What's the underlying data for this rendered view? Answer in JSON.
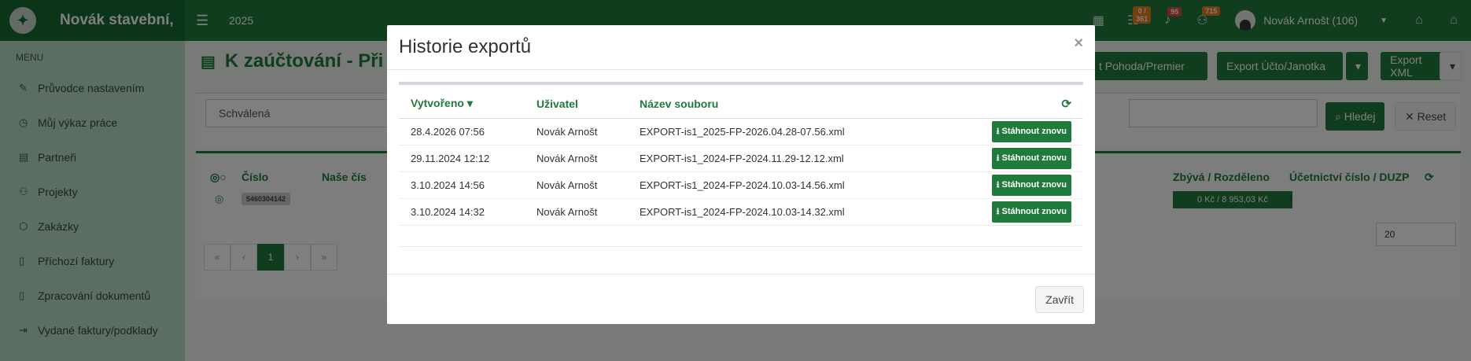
{
  "topbar": {
    "brand": "Novák stavební,",
    "year": "2025",
    "badge_tasks": "0 / 361",
    "badge_bell": "95",
    "badge_users": "715",
    "user_name": "Novák Arnošt (106)"
  },
  "sidebar": {
    "menu_header": "MENU",
    "items": [
      {
        "label": "Průvodce nastavením",
        "icon": "pencil-icon"
      },
      {
        "label": "Můj výkaz práce",
        "icon": "clock-icon"
      },
      {
        "label": "Partneři",
        "icon": "building-icon"
      },
      {
        "label": "Projekty",
        "icon": "users-icon"
      },
      {
        "label": "Zakázky",
        "icon": "cube-icon"
      },
      {
        "label": "Příchozí faktury",
        "icon": "file-icon"
      },
      {
        "label": "Zpracování dokumentů",
        "icon": "file-icon"
      },
      {
        "label": "Vydané faktury/podklady",
        "icon": "file-export-icon"
      }
    ]
  },
  "page": {
    "title": "K zaúčtování - Při",
    "btn_pohoda": "t Pohoda/Premier",
    "btn_ucto": "Export Účto/Janotka",
    "btn_xml": "Export XML",
    "filter_value": "Schválená",
    "btn_search": "Hledej",
    "btn_reset": "Reset",
    "col_cislo": "Číslo",
    "col_nase": "Naše čís",
    "col_zbyva": "Zbývá / Rozděleno",
    "col_ucetni": "Účetnictví číslo / DUZP",
    "row_id": "5460304142",
    "row_amount": "0 Kč / 8 953,03 Kč",
    "row_ucetni": "/",
    "page_size": "20",
    "pager": [
      "«",
      "‹",
      "1",
      "›",
      "»"
    ]
  },
  "modal": {
    "title": "Historie exportů",
    "close_x": "×",
    "columns": {
      "created": "Vytvořeno",
      "user": "Uživatel",
      "file": "Název souboru"
    },
    "download_label": "Stáhnout znovu",
    "rows": [
      {
        "created": "28.4.2026 07:56",
        "user": "Novák Arnošt",
        "file": "EXPORT-is1_2025-FP-2026.04.28-07.56.xml"
      },
      {
        "created": "29.11.2024 12:12",
        "user": "Novák Arnošt",
        "file": "EXPORT-is1_2024-FP-2024.11.29-12.12.xml"
      },
      {
        "created": "3.10.2024 14:56",
        "user": "Novák Arnošt",
        "file": "EXPORT-is1_2024-FP-2024.10.03-14.56.xml"
      },
      {
        "created": "3.10.2024 14:32",
        "user": "Novák Arnošt",
        "file": "EXPORT-is1_2024-FP-2024.10.03-14.32.xml"
      }
    ],
    "close_button": "Zavřít"
  }
}
